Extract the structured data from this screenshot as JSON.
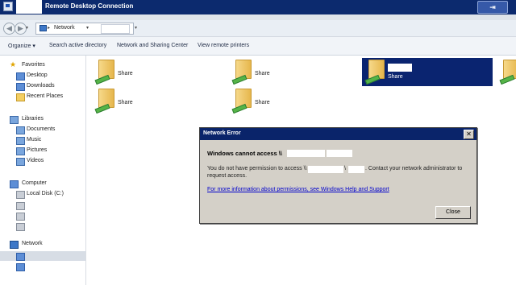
{
  "window": {
    "title": "Remote Desktop Connection",
    "restore_glyph": "⇥"
  },
  "address": {
    "back_glyph": "◀",
    "forward_glyph": "▶",
    "recent_glyph": "▾",
    "separator": "▸",
    "location": "Network",
    "dropdown_glyph": "▾"
  },
  "toolbar": {
    "organize": "Organize",
    "organize_arrow": "▾",
    "search_ad": "Search active directory",
    "network_sharing": "Network and Sharing Center",
    "view_printers": "View remote printers"
  },
  "sidebar": {
    "favorites": {
      "label": "Favorites",
      "items": [
        "Desktop",
        "Downloads",
        "Recent Places"
      ]
    },
    "libraries": {
      "label": "Libraries",
      "items": [
        "Documents",
        "Music",
        "Pictures",
        "Videos"
      ]
    },
    "computer": {
      "label": "Computer",
      "items": [
        "Local Disk (C:)"
      ]
    },
    "network": {
      "label": "Network"
    }
  },
  "shares": [
    {
      "label": "Share"
    },
    {
      "label": "Share"
    },
    {
      "label": "Share",
      "selected": true
    },
    {
      "label": "Share"
    },
    {
      "label": "Share"
    }
  ],
  "dialog": {
    "title": "Network Error",
    "close_glyph": "✕",
    "heading": "Windows cannot access \\\\",
    "message_part1": "You do not have permission to access \\\\",
    "message_sep": "\\",
    "message_part2": ". Contact your network administrator to",
    "message_line2": "request access.",
    "link": "For more information about permissions, see Windows Help and Support",
    "close_button": "Close"
  }
}
